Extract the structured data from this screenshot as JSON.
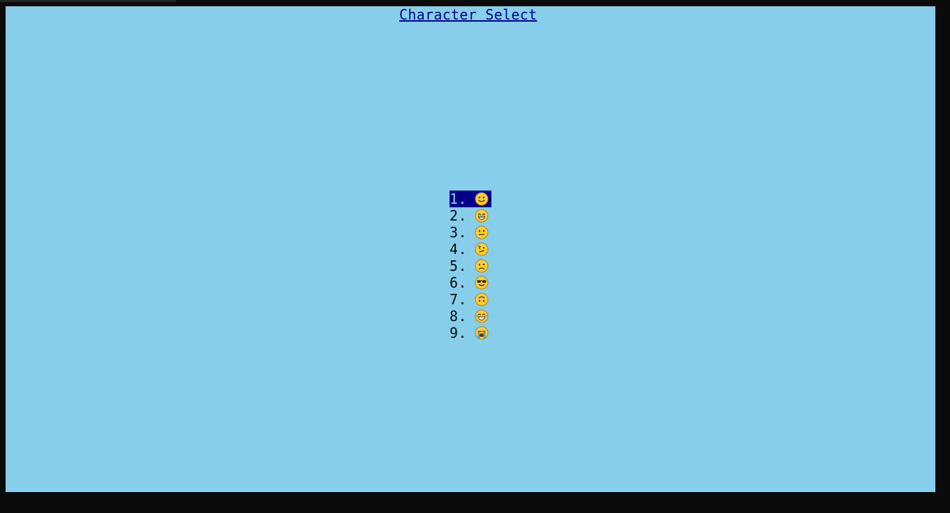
{
  "screen": {
    "title": "Character Select"
  },
  "menu": {
    "selected_index": 0,
    "items": [
      {
        "number": "1.",
        "icon": "slightly-smiling-face-icon"
      },
      {
        "number": "2.",
        "icon": "grinning-smiling-eyes-face-icon"
      },
      {
        "number": "3.",
        "icon": "neutral-face-icon"
      },
      {
        "number": "4.",
        "icon": "confused-face-icon"
      },
      {
        "number": "5.",
        "icon": "slightly-frowning-face-icon"
      },
      {
        "number": "6.",
        "icon": "sunglasses-face-icon"
      },
      {
        "number": "7.",
        "icon": "upside-down-face-icon"
      },
      {
        "number": "8.",
        "icon": "tears-of-joy-face-icon"
      },
      {
        "number": "9.",
        "icon": "loudly-crying-face-icon"
      }
    ]
  },
  "colors": {
    "screen_background": "#87ceeb",
    "accent": "#00008b",
    "frame": "#0b0b0b",
    "emoji_face": "#ffcc33"
  }
}
